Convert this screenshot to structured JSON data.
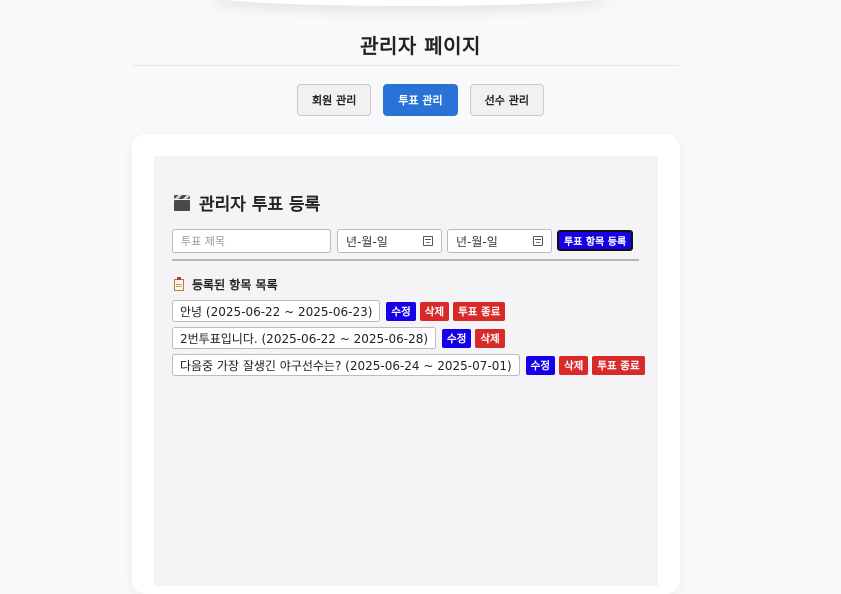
{
  "page_title": "관리자 페이지",
  "tabs": [
    {
      "label": "회원 관리",
      "active": false
    },
    {
      "label": "투표 관리",
      "active": true
    },
    {
      "label": "선수 관리",
      "active": false
    }
  ],
  "vote_form": {
    "heading": "관리자 투표 등록",
    "title_placeholder": "투표 제목",
    "start_date_placeholder": "년-월-일",
    "end_date_placeholder": "년-월-일",
    "register_button": "투표 항목 등록"
  },
  "list": {
    "heading": "등록된 항목 목록",
    "edit_label": "수정",
    "delete_label": "삭제",
    "end_label": "투표 종료",
    "items": [
      {
        "text": "안녕 (2025-06-22 ~ 2025-06-23)",
        "has_end": true
      },
      {
        "text": "2번투표입니다. (2025-06-22 ~ 2025-06-28)",
        "has_end": false
      },
      {
        "text": "다음중 가장 잘생긴 야구선수는? (2025-06-24 ~ 2025-07-01)",
        "has_end": true
      }
    ]
  },
  "colors": {
    "active_tab": "#2a73d6",
    "primary_button": "#1500e8",
    "danger_button": "#d92a2a"
  },
  "icons": {
    "section_heading": "clapperboard-icon",
    "list_heading": "clipboard-icon",
    "date_picker": "calendar-icon"
  }
}
